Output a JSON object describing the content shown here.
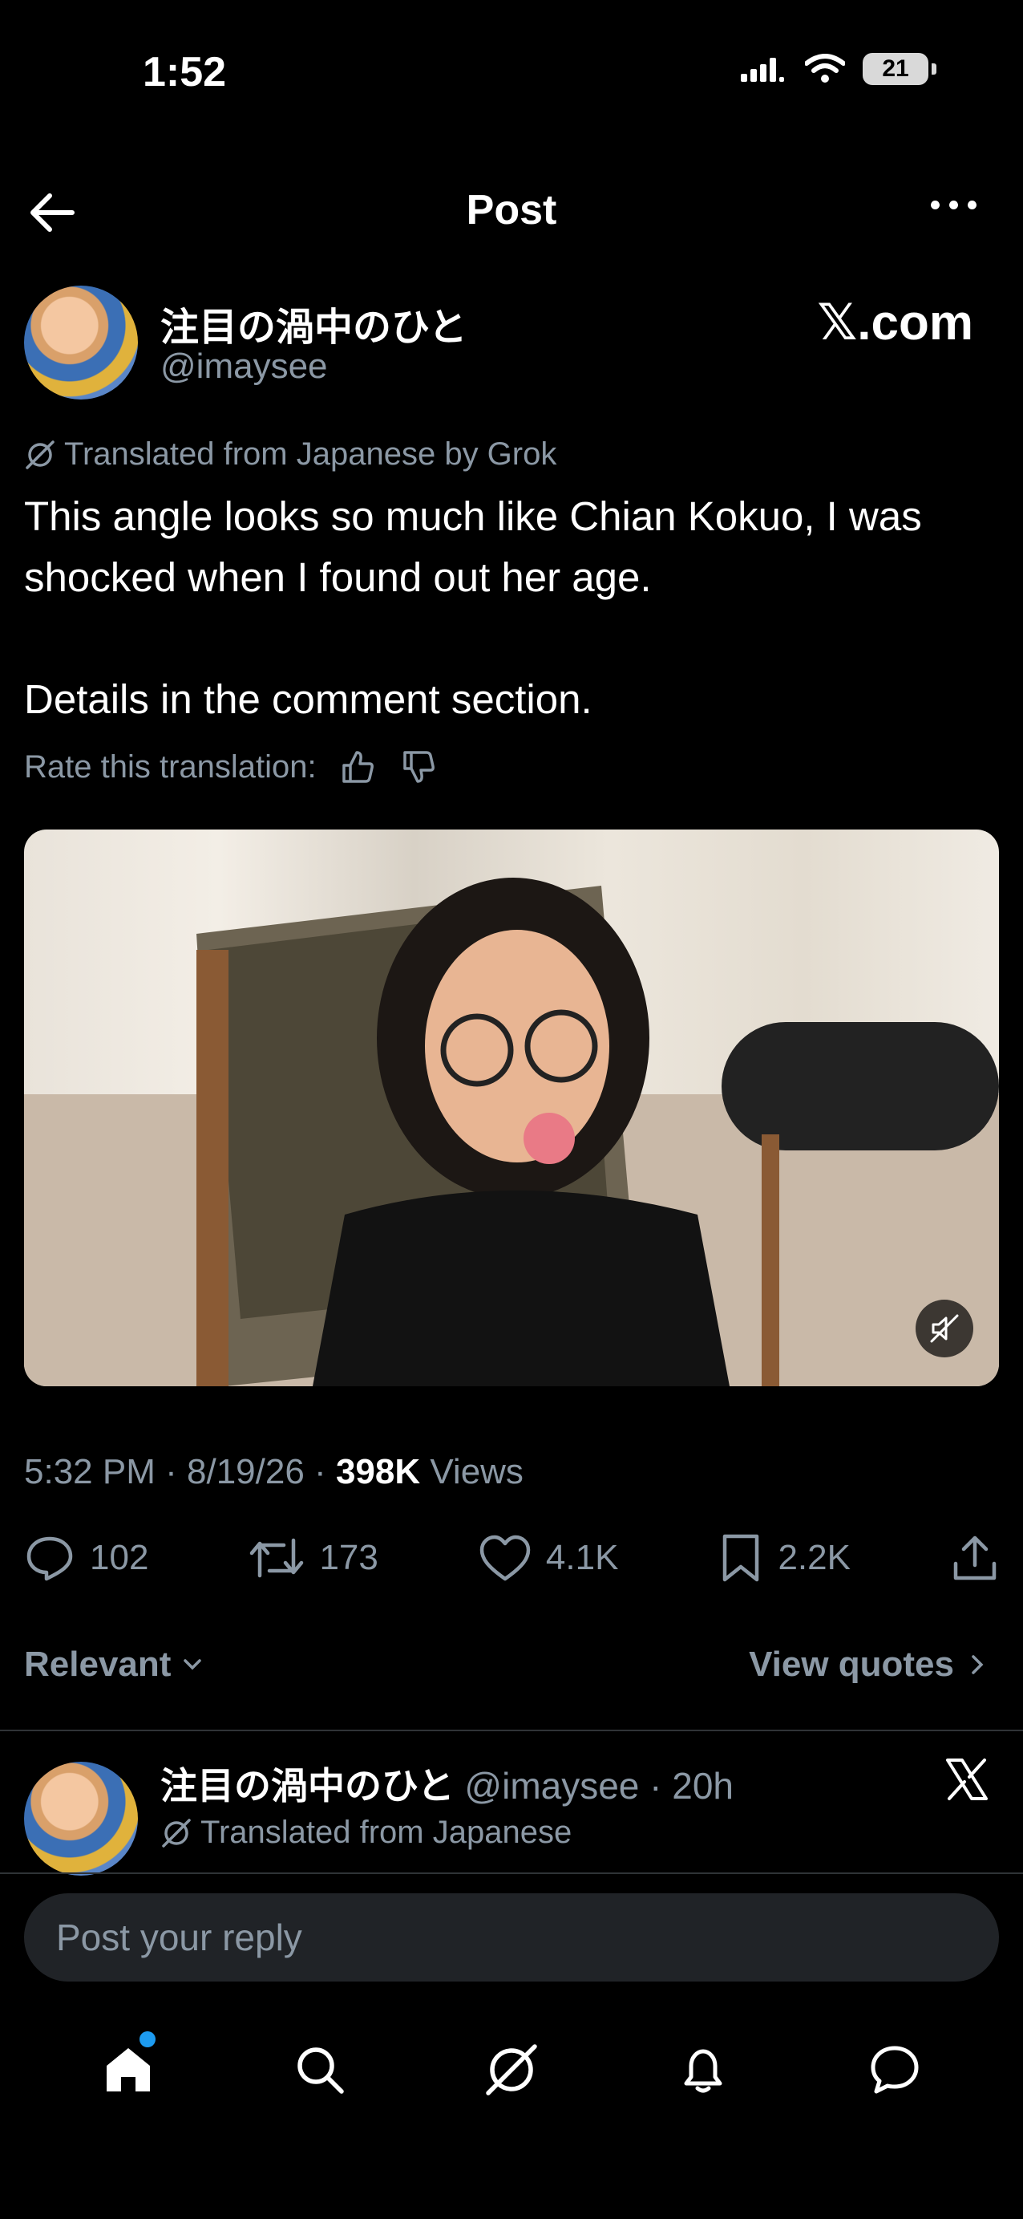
{
  "status_bar": {
    "time": "1:52",
    "battery": "21"
  },
  "header": {
    "title": "Post"
  },
  "author": {
    "name": "注目の渦中のひと",
    "handle": "@imaysee",
    "watermark": "𝕏.com"
  },
  "post": {
    "translated_label": "Translated from Japanese by Grok",
    "text": "This angle looks so much like Chian Kokuo, I was shocked when I found out her age.\n\nDetails in the comment section.",
    "rate_label": "Rate this translation:"
  },
  "meta": {
    "time": "5:32 PM",
    "date": "8/19/26",
    "views_count": "398K",
    "views_label": "Views",
    "sep": "·"
  },
  "actions": {
    "replies": "102",
    "reposts": "173",
    "likes": "4.1K",
    "bookmarks": "2.2K"
  },
  "sort": {
    "relevant": "Relevant",
    "view_quotes": "View quotes"
  },
  "reply": {
    "name": "注目の渦中のひと",
    "handle_time": "@imaysee · 20h",
    "translated_label": "Translated from Japanese"
  },
  "reply_box": {
    "placeholder": "Post your reply"
  },
  "colors": {
    "accent": "#1d9bf0",
    "background": "#000000",
    "muted": "#8b98a5"
  }
}
